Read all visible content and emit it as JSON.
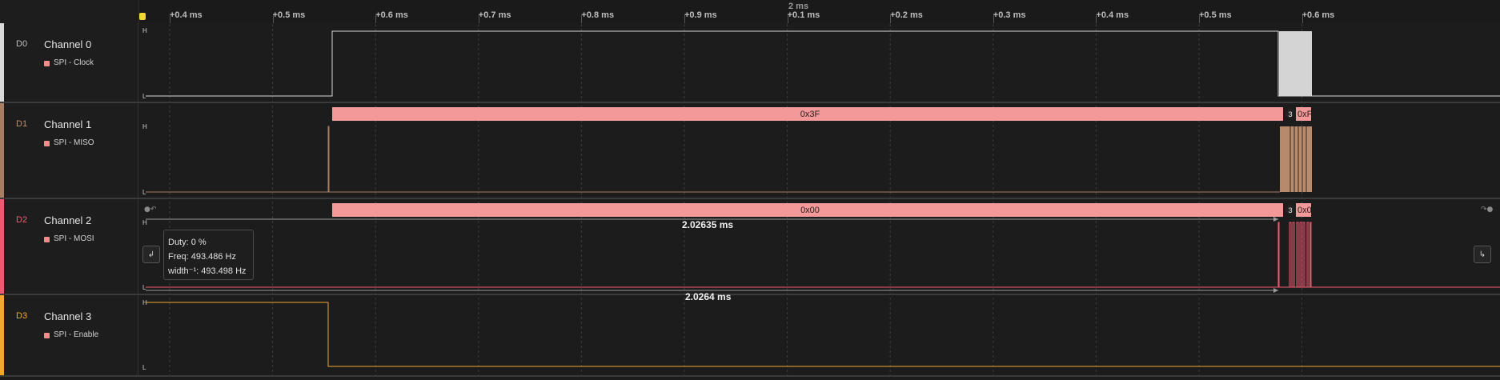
{
  "ruler": {
    "center_label": "2 ms",
    "ticks": [
      "+0.4 ms",
      "+0.5 ms",
      "+0.6 ms",
      "+0.7 ms",
      "+0.8 ms",
      "+0.9 ms",
      "+0.1 ms",
      "+0.2 ms",
      "+0.3 ms",
      "+0.4 ms",
      "+0.5 ms",
      "+0.6 ms"
    ]
  },
  "channels": [
    {
      "id": "D0",
      "name": "Channel 0",
      "analyzer": "SPI - Clock",
      "color": "#d9d9d9",
      "id_color": "#bdbdbd"
    },
    {
      "id": "D1",
      "name": "Channel 1",
      "analyzer": "SPI - MISO",
      "color": "#a87d62",
      "id_color": "#c98d6a"
    },
    {
      "id": "D2",
      "name": "Channel 2",
      "analyzer": "SPI - MOSI",
      "color": "#ef5a72",
      "id_color": "#ef5a72"
    },
    {
      "id": "D3",
      "name": "Channel 3",
      "analyzer": "SPI - Enable",
      "color": "#f0a830",
      "id_color": "#f0a830"
    }
  ],
  "levels": {
    "high": "H",
    "low": "L"
  },
  "decodes": {
    "miso_main": "0x3F",
    "miso_badge": "3",
    "miso_next": "0xF",
    "mosi_main": "0x00",
    "mosi_badge": "3",
    "mosi_next": "0x0"
  },
  "measurements": {
    "width_top": "2.02635 ms",
    "width_bottom": "2.0264 ms"
  },
  "tooltip": {
    "duty": "Duty: 0 %",
    "freq": "Freq: 493.486 Hz",
    "width": "width⁻¹: 493.498 Hz"
  },
  "colors": {
    "decode": "#f49999",
    "clock": "#d9d9d9",
    "miso": "#a87d62",
    "mosi": "#ef5a72",
    "enable": "#f0a830"
  }
}
